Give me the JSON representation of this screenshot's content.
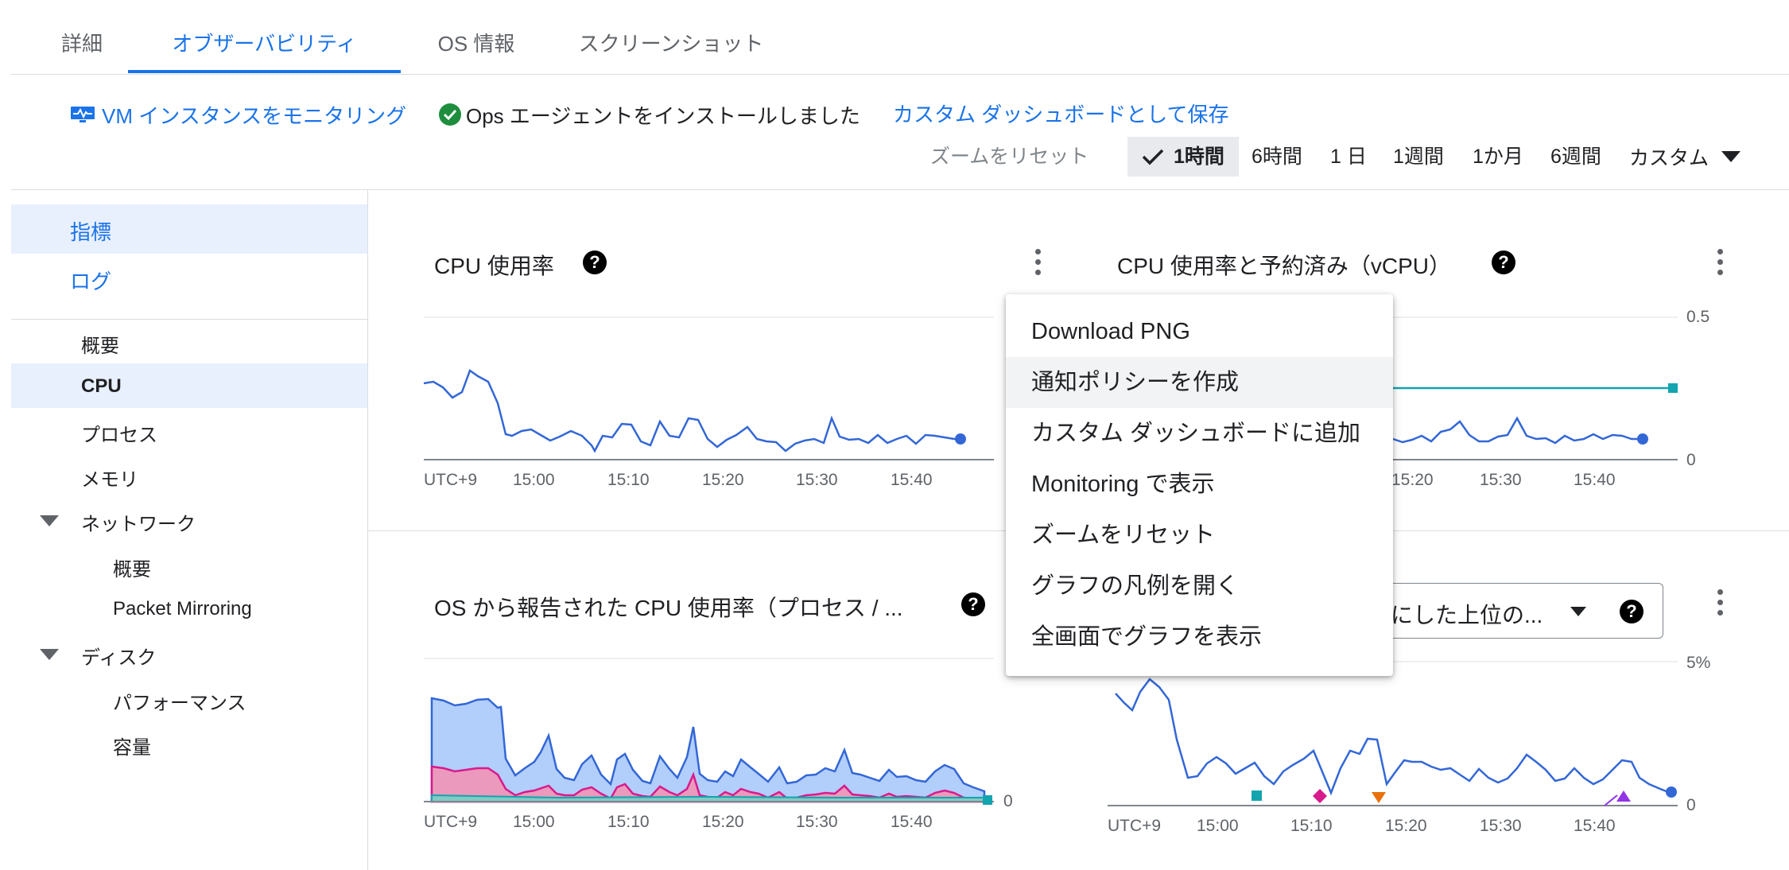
{
  "tabs": [
    "詳細",
    "オブザーバビリティ",
    "OS 情報",
    "スクリーンショット"
  ],
  "toolbar": {
    "monitor_link": "VM インスタンスをモニタリング",
    "agent_status": "Ops エージェントをインストールしました",
    "save_dashboard": "カスタム ダッシュボードとして保存"
  },
  "zoom": {
    "reset": "ズームをリセット",
    "ranges": [
      "1時間",
      "6時間",
      "1 日",
      "1週間",
      "1か月",
      "6週間"
    ],
    "selected": "1時間",
    "custom": "カスタム"
  },
  "sidebar": {
    "metrics": "指標",
    "logs": "ログ",
    "items": [
      "概要",
      "CPU",
      "プロセス",
      "メモリ",
      "ネットワーク",
      "概要",
      "Packet Mirroring",
      "ディスク",
      "パフォーマンス",
      "容量"
    ],
    "selected": "CPU"
  },
  "panels": {
    "cpu_util_title": "CPU 使用率",
    "cpu_reserved_title": "CPU 使用率と予約済み（vCPU）",
    "os_cpu_title": "OS から報告された CPU 使用率（プロセス / ...",
    "top_select_value": "にした上位の...",
    "help": "?",
    "y_ticks_right_top": [
      "0.5",
      "0"
    ],
    "y_ticks_right_bottom": [
      "5%",
      "0"
    ],
    "y_tick_bottom_left": "0"
  },
  "x_axis": {
    "tz": "UTC+9",
    "ticks": [
      "15:00",
      "15:10",
      "15:20",
      "15:30",
      "15:40"
    ]
  },
  "context_menu": {
    "items": [
      "Download PNG",
      "通知ポリシーを作成",
      "カスタム ダッシュボードに追加",
      "Monitoring で表示",
      "ズームをリセット",
      "グラフの凡例を開く",
      "全画面でグラフを表示"
    ],
    "hovered": "通知ポリシーを作成"
  },
  "colors": {
    "accent": "#1a73e8",
    "line": "#3367d6",
    "reserved": "#12a4af",
    "pink": "#d81b8c",
    "success": "#1e8e3e"
  }
}
